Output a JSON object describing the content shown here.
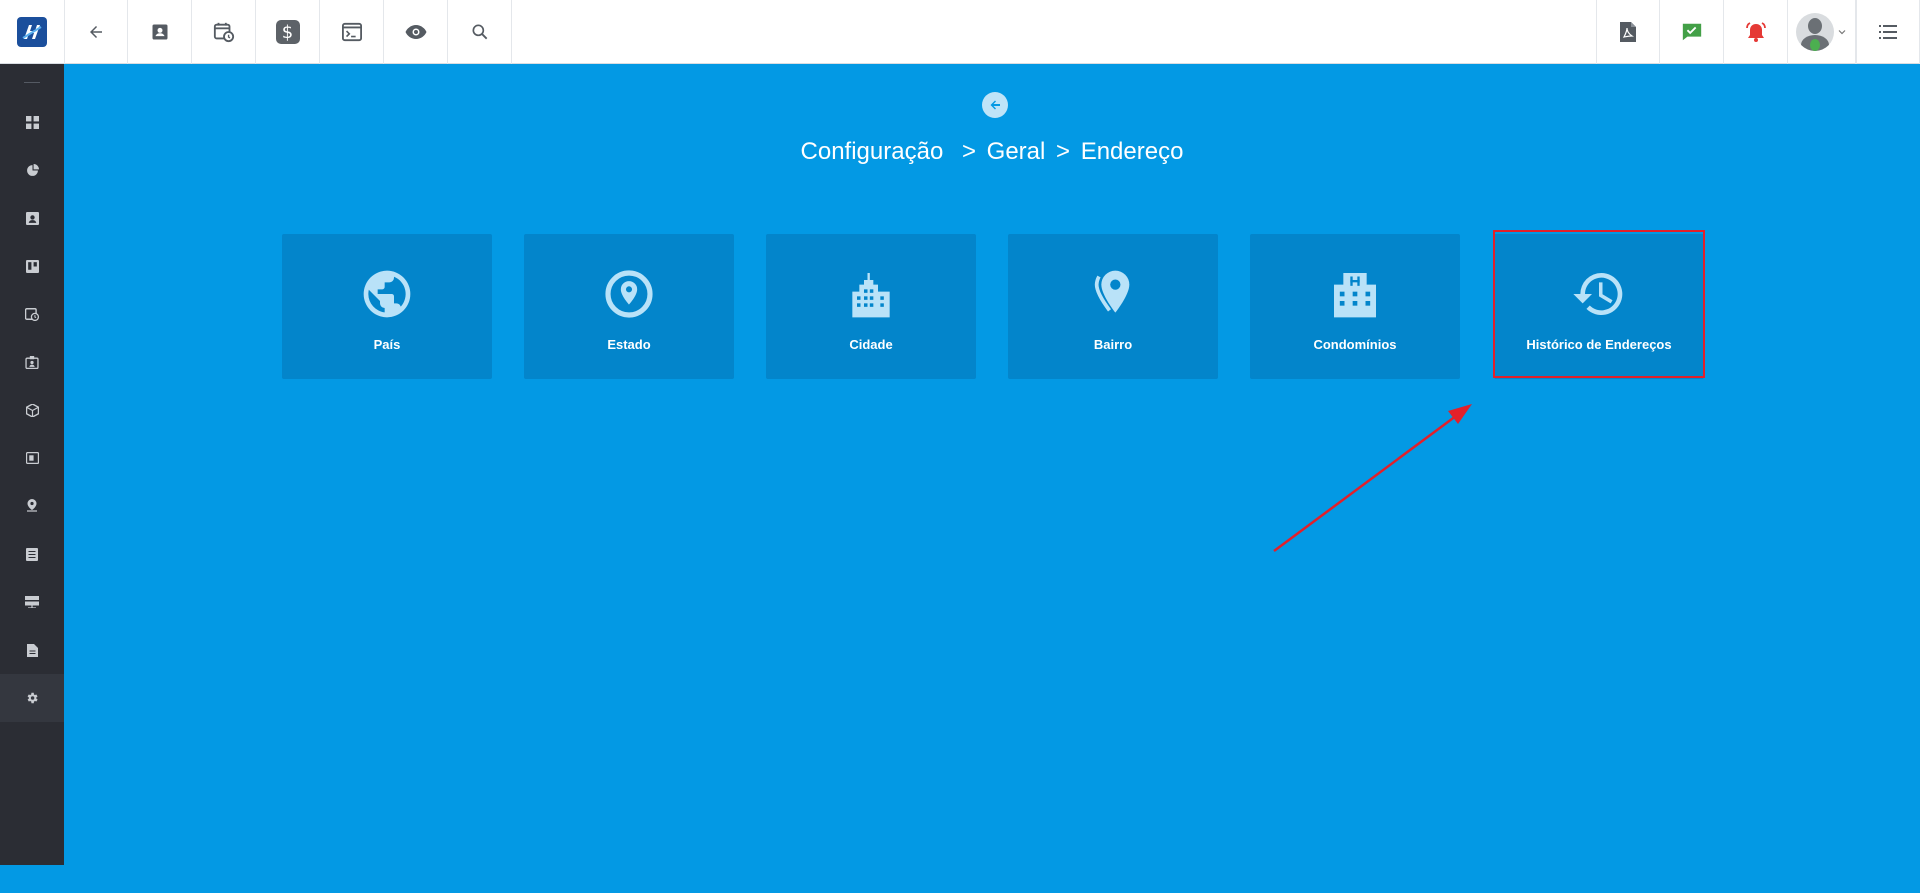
{
  "breadcrumb": {
    "part1": "Configuração",
    "sep1": ">",
    "part2": "Geral",
    "sep2": ">",
    "part3": "Endereço"
  },
  "tiles": [
    {
      "label": "País",
      "icon": "globe-icon"
    },
    {
      "label": "Estado",
      "icon": "location-pin-circle-icon"
    },
    {
      "label": "Cidade",
      "icon": "city-building-icon"
    },
    {
      "label": "Bairro",
      "icon": "map-marker-icon"
    },
    {
      "label": "Condomínios",
      "icon": "hospital-building-icon"
    },
    {
      "label": "Histórico de Endereços",
      "icon": "history-icon"
    }
  ],
  "toolbar": {
    "left_icons": [
      "back-arrow-icon",
      "contact-card-icon",
      "calendar-clock-icon",
      "dollar-icon",
      "terminal-icon",
      "eye-icon",
      "search-icon"
    ],
    "right_icons": [
      "pdf-icon",
      "chat-check-icon",
      "alarm-bell-icon",
      "avatar",
      "menu-list-icon"
    ]
  },
  "sidebar": {
    "icons": [
      "dashboard-icon",
      "pie-chart-icon",
      "contact-icon",
      "board-icon",
      "calendar-clock-icon",
      "id-badge-icon",
      "box-icon",
      "money-icon",
      "location-icon",
      "document-list-icon",
      "server-icon",
      "file-icon",
      "settings-gear-icon"
    ]
  },
  "colors": {
    "main_bg": "#0399e4",
    "tile_bg": "#0385cb",
    "tile_icon": "#b9e2f8",
    "highlight": "#e3202a",
    "sidebar_bg": "#2b2d34",
    "dollar_badge": "#5d6268",
    "chat_green": "#43a047",
    "alarm_red": "#e53935"
  }
}
